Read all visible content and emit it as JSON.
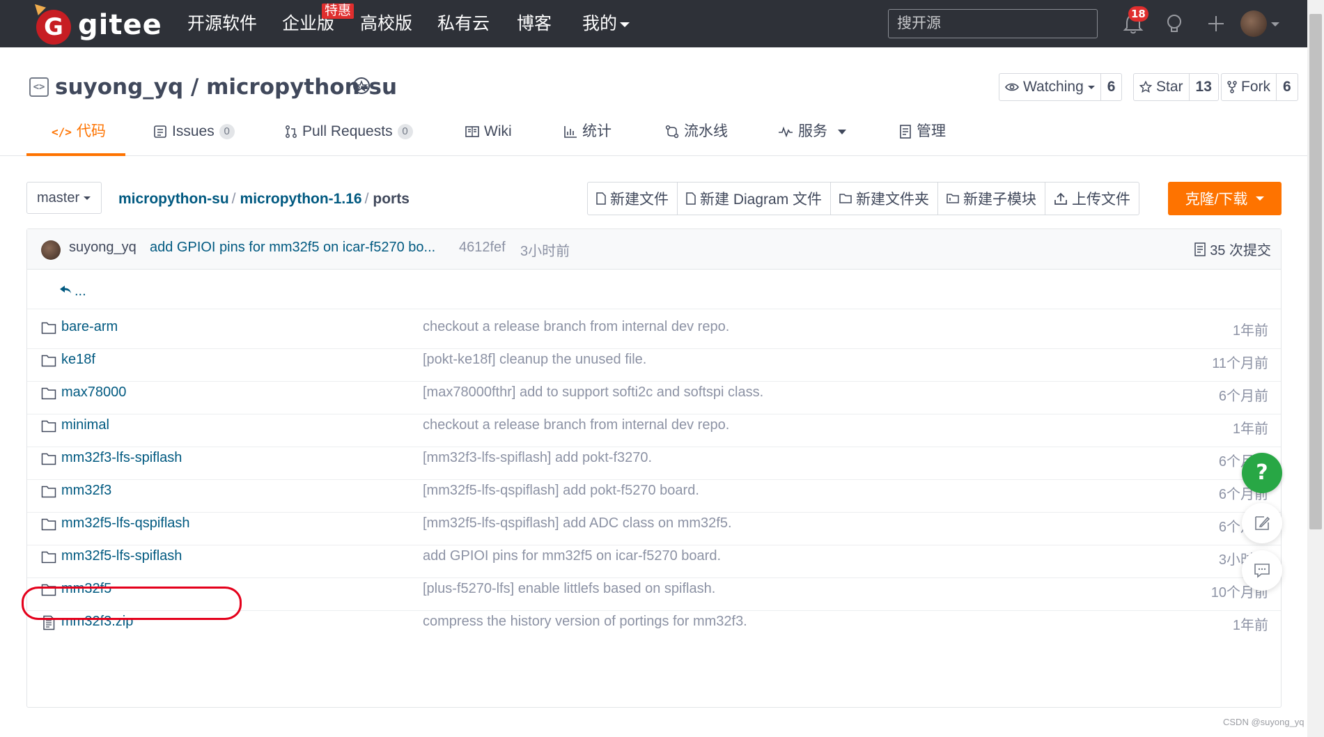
{
  "nav": {
    "logo_text": "gitee",
    "logo_letter": "G",
    "items": [
      "开源软件",
      "企业版",
      "高校版",
      "私有云",
      "博客",
      "我的"
    ],
    "promo_tag": "特惠",
    "search_placeholder": "搜开源",
    "notification_count": "18"
  },
  "repo": {
    "owner": "suyong_yq",
    "separator": " / ",
    "name": "micropython-su",
    "watch_label": "Watching",
    "watch_count": "6",
    "star_label": "Star",
    "star_count": "13",
    "fork_label": "Fork",
    "fork_count": "6"
  },
  "tabs": [
    {
      "label": "代码",
      "count": null
    },
    {
      "label": "Issues",
      "count": "0"
    },
    {
      "label": "Pull Requests",
      "count": "0"
    },
    {
      "label": "Wiki",
      "count": null
    },
    {
      "label": "统计",
      "count": null
    },
    {
      "label": "流水线",
      "count": null
    },
    {
      "label": "服务",
      "count": null
    },
    {
      "label": "管理",
      "count": null
    }
  ],
  "toolbar": {
    "branch": "master",
    "breadcrumb": [
      "micropython-su",
      "micropython-1.16",
      "ports"
    ],
    "buttons": [
      "新建文件",
      "新建 Diagram 文件",
      "新建文件夹",
      "新建子模块",
      "上传文件"
    ],
    "clone_label": "克隆/下载"
  },
  "commit": {
    "author": "suyong_yq",
    "message": "add GPIOI pins for mm32f5 on icar-f5270 bo...",
    "sha": "4612fef",
    "time": "3小时前",
    "count_label": "35 次提交"
  },
  "parent_dir": "...",
  "files": [
    {
      "name": "bare-arm",
      "type": "folder",
      "message": "checkout a release branch from internal dev repo.",
      "time": "1年前"
    },
    {
      "name": "ke18f",
      "type": "folder",
      "message": "[pokt-ke18f] cleanup the unused file.",
      "time": "11个月前"
    },
    {
      "name": "max78000",
      "type": "folder",
      "message": "[max78000fthr] add to support softi2c and softspi class.",
      "time": "6个月前"
    },
    {
      "name": "minimal",
      "type": "folder",
      "message": "checkout a release branch from internal dev repo.",
      "time": "1年前"
    },
    {
      "name": "mm32f3-lfs-spiflash",
      "type": "folder",
      "message": "[mm32f3-lfs-spiflash] add pokt-f3270.",
      "time": "6个月前"
    },
    {
      "name": "mm32f3",
      "type": "folder",
      "message": "[mm32f5-lfs-qspiflash] add pokt-f5270 board.",
      "time": "6个月前"
    },
    {
      "name": "mm32f5-lfs-qspiflash",
      "type": "folder",
      "message": "[mm32f5-lfs-qspiflash] add ADC class on mm32f5.",
      "time": "6个月前"
    },
    {
      "name": "mm32f5-lfs-spiflash",
      "type": "folder",
      "message": "add GPIOI pins for mm32f5 on icar-f5270 board.",
      "time": "3小时前"
    },
    {
      "name": "mm32f5",
      "type": "folder",
      "message": "[plus-f5270-lfs] enable littlefs based on spiflash.",
      "time": "10个月前"
    },
    {
      "name": "mm32f3.zip",
      "type": "file",
      "message": "compress the history version of portings for mm32f3.",
      "time": "1年前"
    }
  ],
  "help_label": "?",
  "watermark": "CSDN @suyong_yq"
}
